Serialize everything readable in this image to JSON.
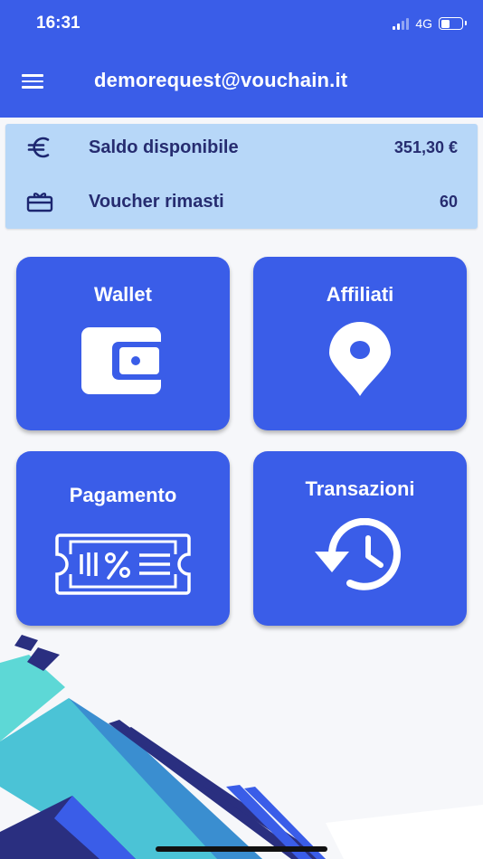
{
  "status_bar": {
    "time": "16:31",
    "network": "4G",
    "battery_level": 0.45
  },
  "header": {
    "title": "demorequest@vouchain.it",
    "menu_icon": "hamburger-menu-icon"
  },
  "summary": {
    "balance": {
      "icon": "euro-icon",
      "label": "Saldo disponibile",
      "value": "351,30 €"
    },
    "vouchers": {
      "icon": "gift-card-icon",
      "label": "Voucher rimasti",
      "value": "60"
    }
  },
  "tiles": {
    "wallet": {
      "label": "Wallet",
      "icon": "wallet-icon"
    },
    "affiliates": {
      "label": "Affiliati",
      "icon": "map-pin-icon"
    },
    "payment": {
      "label": "Pagamento",
      "icon": "voucher-ticket-icon"
    },
    "transactions": {
      "label": "Transazioni",
      "icon": "history-clock-icon"
    }
  },
  "colors": {
    "primary": "#3a5de8",
    "summary_background": "#b7d7f8",
    "summary_text": "#262c70",
    "decor_teal": "#5ed9dc",
    "decor_navy": "#2a2f80"
  }
}
